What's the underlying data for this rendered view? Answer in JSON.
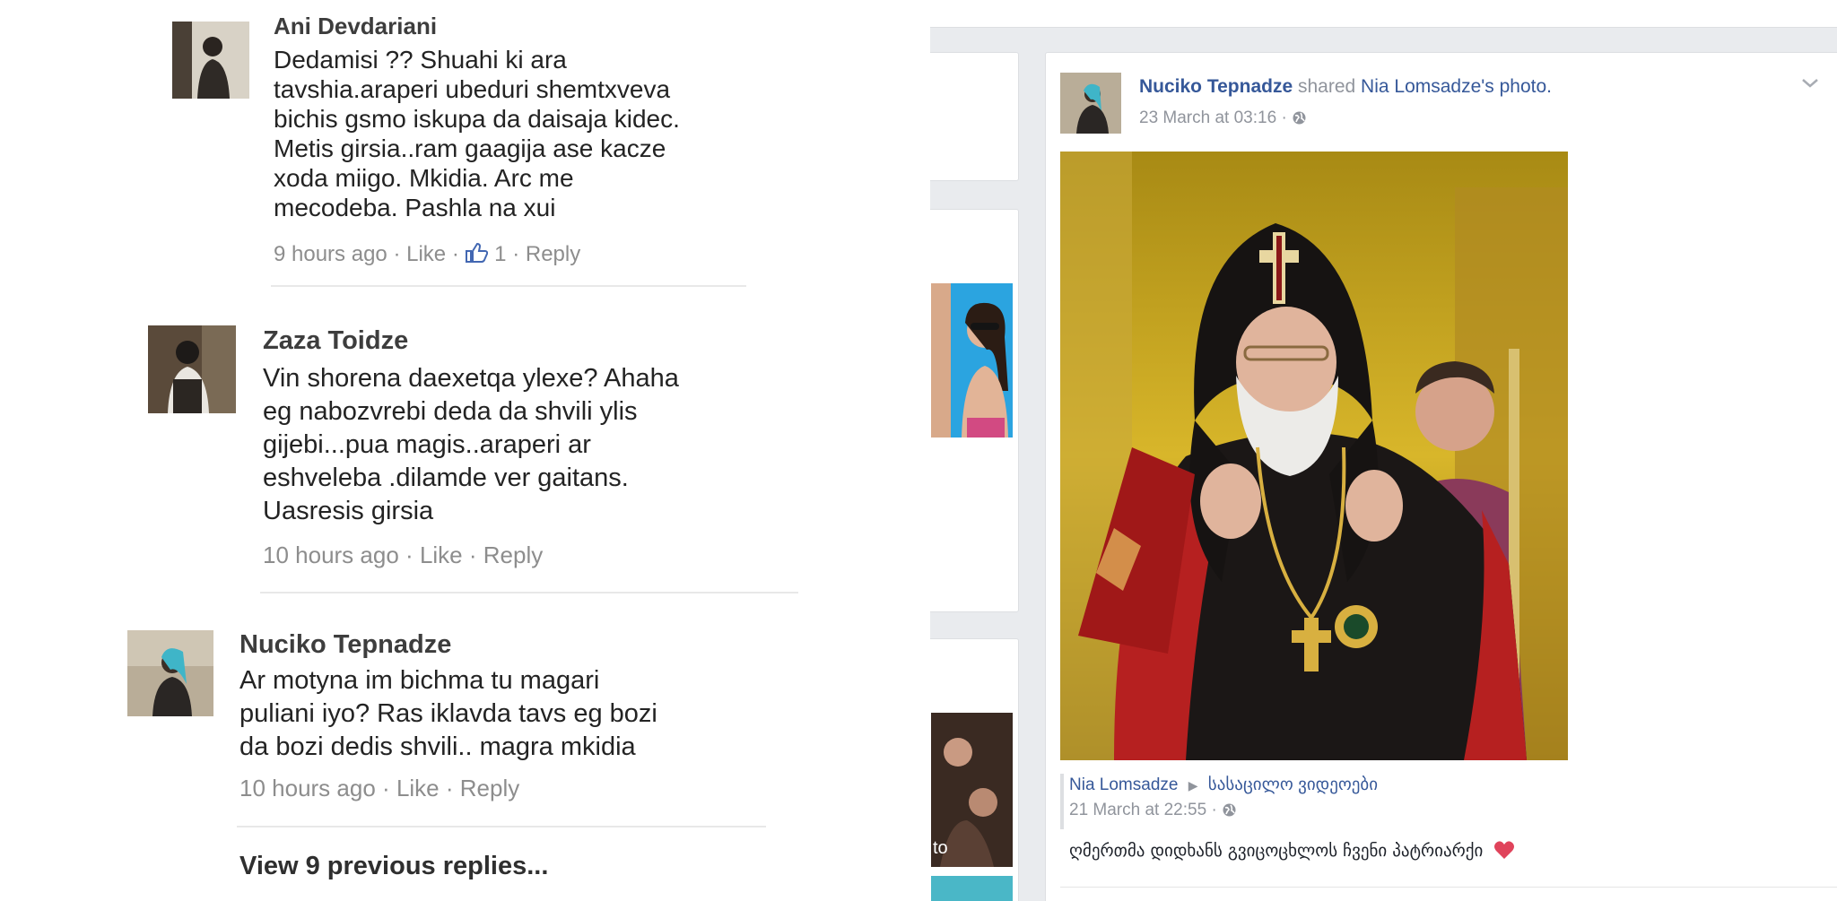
{
  "comments": [
    {
      "author": "Ani Devdariani",
      "lines": [
        "Dedamisi ?? Shuahi ki ara",
        "tavshia.araperi ubeduri shemtxveva",
        "bichis gsmo iskupa da daisaja kidec.",
        "Metis girsia..ram gaagija ase kacze",
        "xoda miigo. Mkidia. Arc me",
        "mecodeba. Pashla na  xui"
      ],
      "time": "9 hours ago",
      "like_label": "Like",
      "like_count": "1",
      "reply_label": "Reply"
    },
    {
      "author": "Zaza Toidze",
      "lines": [
        "Vin shorena daexetqa ylexe? Ahaha",
        "eg nabozvrebi deda da shvili ylis",
        "gijebi...pua magis..araperi ar",
        "eshveleba .dilamde ver gaitans.",
        "Uasresis girsia"
      ],
      "time": "10 hours ago",
      "like_label": "Like",
      "reply_label": "Reply"
    },
    {
      "author": "Nuciko Tepnadze",
      "lines": [
        "Ar motyna im bichma tu magari",
        "puliani iyo? Ras iklavda tavs eg bozi",
        "da bozi dedis shvili.. magra mkidia"
      ],
      "time": "10 hours ago",
      "like_label": "Like",
      "reply_label": "Reply"
    }
  ],
  "view_previous": "View 9 previous replies...",
  "feed": {
    "sidebar_photo_caption": "to",
    "post": {
      "author": "Nuciko Tepnadze",
      "action": "shared",
      "shared_from": "Nia Lomsadze's photo.",
      "time": "23 March at 03:16",
      "privacy_icon": "globe-icon",
      "shared": {
        "author": "Nia Lomsadze",
        "target": "სასაცილო ვიდეოები",
        "time": "21 March at 22:55",
        "caption": "ღმერთმა დიდხანს გვიცოცხლოს ჩვენი პატრიარქი",
        "emoji": "heart-icon"
      }
    }
  },
  "colors": {
    "link": "#365899",
    "meta": "#90949c",
    "heart": "#e0435b"
  }
}
